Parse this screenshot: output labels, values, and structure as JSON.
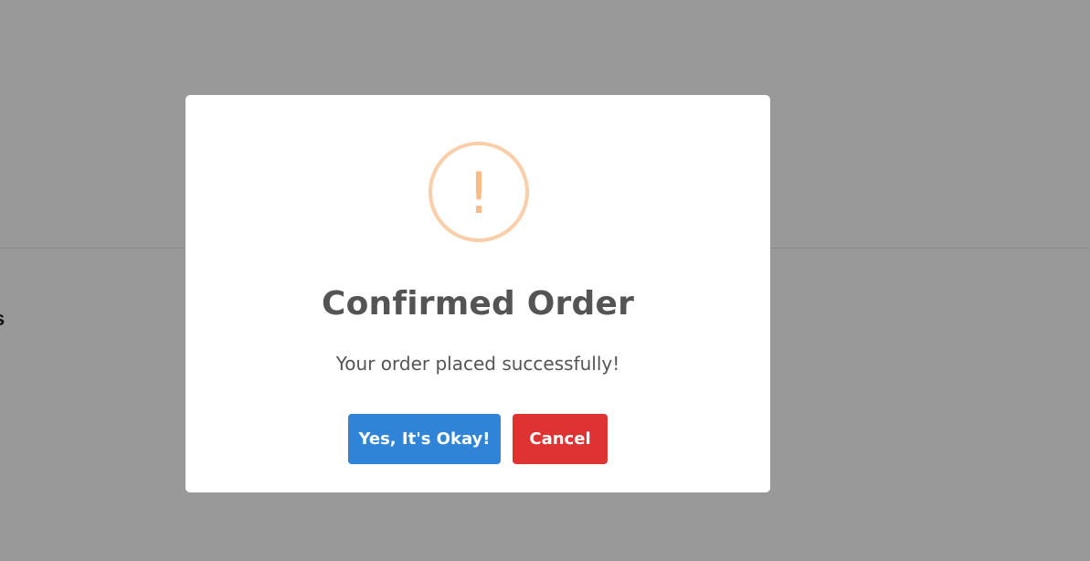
{
  "background": {
    "partial_text": "s"
  },
  "dialog": {
    "icon": "warning-icon",
    "icon_glyph": "!",
    "title": "Confirmed Order",
    "message": "Your order placed successfully!",
    "confirm_label": "Yes, It's Okay!",
    "cancel_label": "Cancel"
  },
  "colors": {
    "overlay": "#999999",
    "icon_border": "#facea8",
    "icon_mark": "#f8bb86",
    "confirm_button": "#2f84d8",
    "cancel_button": "#dd3333",
    "text": "#545454"
  }
}
